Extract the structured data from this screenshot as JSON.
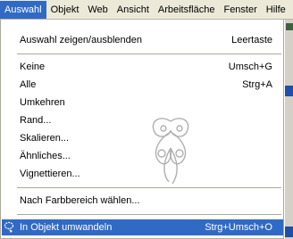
{
  "menubar": {
    "items": [
      "Auswahl",
      "Objekt",
      "Web",
      "Ansicht",
      "Arbeitsfläche",
      "Fenster",
      "Hilfe"
    ]
  },
  "menu": {
    "items": [
      {
        "label": "Auswahl zeigen/ausblenden",
        "shortcut": "Leertaste"
      },
      {
        "label": "Keine",
        "shortcut": "Umsch+G"
      },
      {
        "label": "Alle",
        "shortcut": "Strg+A"
      },
      {
        "label": "Umkehren",
        "shortcut": ""
      },
      {
        "label": "Rand...",
        "shortcut": ""
      },
      {
        "label": "Skalieren...",
        "shortcut": ""
      },
      {
        "label": "Ähnliches...",
        "shortcut": ""
      },
      {
        "label": "Vignettieren...",
        "shortcut": ""
      },
      {
        "label": "Nach Farbbereich wählen...",
        "shortcut": ""
      },
      {
        "label": "In Objekt umwandeln",
        "shortcut": "Strg+Umsch+O"
      }
    ]
  },
  "colors": {
    "highlight": "#316ac5",
    "menubar": "#ece9d8"
  },
  "icons": {
    "selection": "lasso-selection-icon",
    "decoration": "butterfly-watermark-icon"
  }
}
